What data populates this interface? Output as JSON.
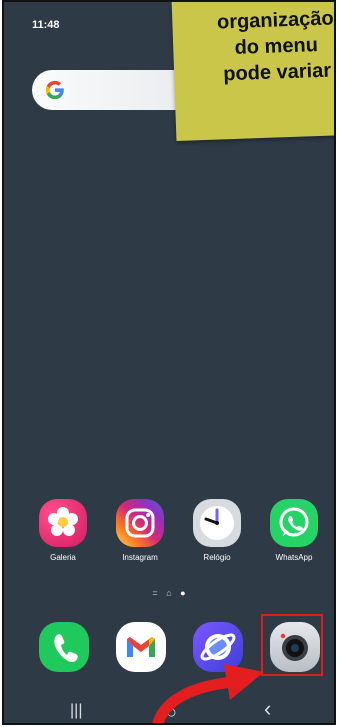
{
  "status_bar": {
    "time": "11:48"
  },
  "search": {
    "logo_letter": "G"
  },
  "overlay_note": {
    "text": "organização\ndo menu\npode variar",
    "color": "#c9c64a"
  },
  "home_apps": [
    {
      "label": "Galeria",
      "icon": "gallery-flower-icon"
    },
    {
      "label": "Instagram",
      "icon": "instagram-camera-icon"
    },
    {
      "label": "Relógio",
      "icon": "clock-icon"
    },
    {
      "label": "WhatsApp",
      "icon": "whatsapp-phone-icon"
    }
  ],
  "page_indicator": {
    "pages": 3,
    "current": 3
  },
  "dock": [
    {
      "icon": "phone-icon"
    },
    {
      "icon": "gmail-icon"
    },
    {
      "icon": "internet-browser-icon"
    },
    {
      "icon": "camera-icon"
    }
  ],
  "nav_bar": {
    "recents_glyph": "|||",
    "home_glyph": "○",
    "back_glyph": "‹"
  },
  "annotation": {
    "highlight_color": "#e01d1d",
    "target": "camera-icon"
  }
}
